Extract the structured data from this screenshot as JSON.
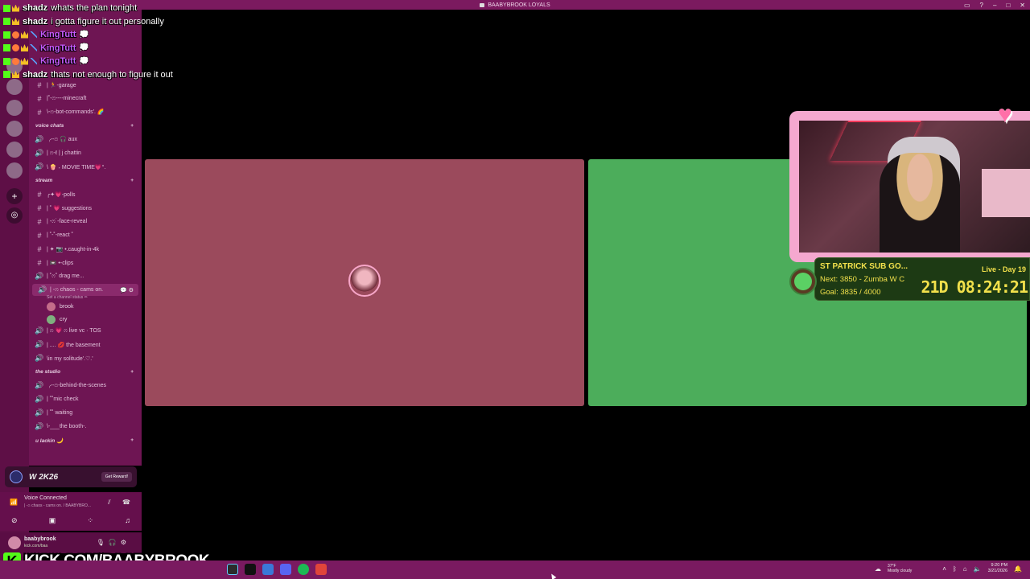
{
  "window": {
    "title": "BAABYBROOK LOYALS"
  },
  "chat": [
    {
      "name": "shadz",
      "text": "whats the plan tonight",
      "style": "white"
    },
    {
      "name": "shadz",
      "text": "i gotta figure it out personally",
      "style": "white"
    },
    {
      "name": "KingTutt",
      "text": "",
      "style": "purple"
    },
    {
      "name": "KingTutt",
      "text": "",
      "style": "purple"
    },
    {
      "name": "KingTutt",
      "text": "",
      "style": "purple"
    },
    {
      "name": "shadz",
      "text": "thats not enough to figure it out",
      "style": "white"
    }
  ],
  "channels": [
    {
      "label": "| 🏃-garage",
      "type": "text"
    },
    {
      "label": "|˚-ෆ----minecraft",
      "type": "text"
    },
    {
      "label": "\\-ෆ-bot-commands'. 🌈",
      "type": "text"
    },
    {
      "label": "voice chats",
      "type": "category"
    },
    {
      "label": "╭-ෆ 🎧 aux",
      "type": "voice"
    },
    {
      "label": "| ෆ-ℓ | j chattin",
      "type": "voice"
    },
    {
      "label": "\\ 🍿 ˖ MOVIE TIME💗°.",
      "type": "voice"
    },
    {
      "label": "stream",
      "type": "category"
    },
    {
      "label": "╭✦💗-polls",
      "type": "text"
    },
    {
      "label": "| ˚ 💗 suggestions",
      "type": "text"
    },
    {
      "label": "| -ෆ˙-face-reveal",
      "type": "text"
    },
    {
      "label": "| ˚-˚-react ˚",
      "type": "text"
    },
    {
      "label": "| ✦ 📷 •.caught-in-4k",
      "type": "text"
    },
    {
      "label": "| 📼 •-clips",
      "type": "text"
    },
    {
      "label": "| ˚ෆ˚ drag me...",
      "type": "voice"
    },
    {
      "label": "| -ෆ chaos - cams on.",
      "type": "voice-selected",
      "sub": "Set a channel status ✏"
    },
    {
      "label": "| ෆ 💗 ෆ live vc · TOS",
      "type": "voice"
    },
    {
      "label": "| .... 💋 the basement",
      "type": "voice"
    },
    {
      "label": "\\in my solitude'.♡.'",
      "type": "voice"
    },
    {
      "label": "the studio",
      "type": "category"
    },
    {
      "label": "╭-ෆ-behind-the-scenes",
      "type": "voice"
    },
    {
      "label": "| ˚˚mic check",
      "type": "voice"
    },
    {
      "label": "| ˚˚ waiting",
      "type": "voice"
    },
    {
      "label": "\\-___the booth-.",
      "type": "voice"
    },
    {
      "label": "u lackin 🌙",
      "type": "category"
    }
  ],
  "members": [
    {
      "name": "brook",
      "color": "#c46d8a"
    },
    {
      "name": "cry",
      "color": "#7fb07f"
    }
  ],
  "reward": {
    "logo": "W 2K26",
    "button": "Get Reward!"
  },
  "voice": {
    "title": "Voice Connected",
    "sub": "| -ෆ chaos - cams on. / BAABYBRO..."
  },
  "user": {
    "name": "baabybrook",
    "status": "kick.com/baa"
  },
  "goal": {
    "title": "ST PATRICK SUB GO...",
    "next": "Next: 3850 - Zumba W C",
    "progress": "Goal: 3835 / 4000",
    "live": "Live - Day 19",
    "timer": "21D 08:24:21"
  },
  "kick": {
    "badge": "K",
    "url": "KICK.COM/BAABYBROOK"
  },
  "taskbar": {
    "temp": "37°F",
    "weather": "Mostly cloudy",
    "time": "9:20 PM",
    "date": "3/21/2026"
  },
  "colors": {
    "titlebar": "#7b1a5f",
    "pink_tile": "#9b4a5c",
    "green_tile": "#4cad5b",
    "kick_green": "#53fc18",
    "goal_yellow": "#f1e04b"
  }
}
